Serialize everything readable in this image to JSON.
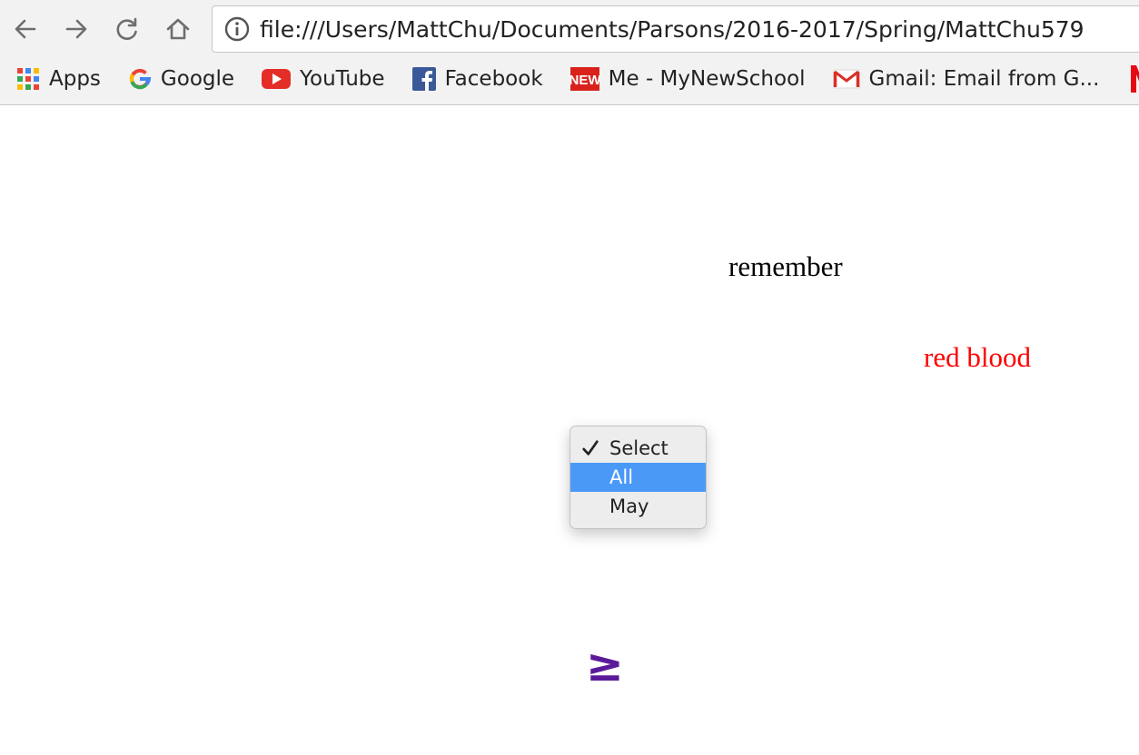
{
  "browser": {
    "url": "file:///Users/MattChu/Documents/Parsons/2016-2017/Spring/MattChu579",
    "bookmarks": [
      {
        "label": "Apps",
        "icon": "apps-grid-icon"
      },
      {
        "label": "Google",
        "icon": "google-icon"
      },
      {
        "label": "YouTube",
        "icon": "youtube-icon"
      },
      {
        "label": "Facebook",
        "icon": "facebook-icon"
      },
      {
        "label": "Me - MyNewSchool",
        "icon": "new-school-icon"
      },
      {
        "label": "Gmail: Email from G...",
        "icon": "gmail-icon"
      }
    ]
  },
  "page": {
    "word_1": "remember",
    "word_2": "red blood",
    "word_2_color": "#ff0000",
    "dropdown": {
      "options": [
        "Select",
        "All",
        "May"
      ],
      "selected": "Select",
      "highlighted": "All",
      "highlight_color": "#4a99f7"
    },
    "link_symbol": "≥",
    "link_color": "#5a1a9a"
  }
}
